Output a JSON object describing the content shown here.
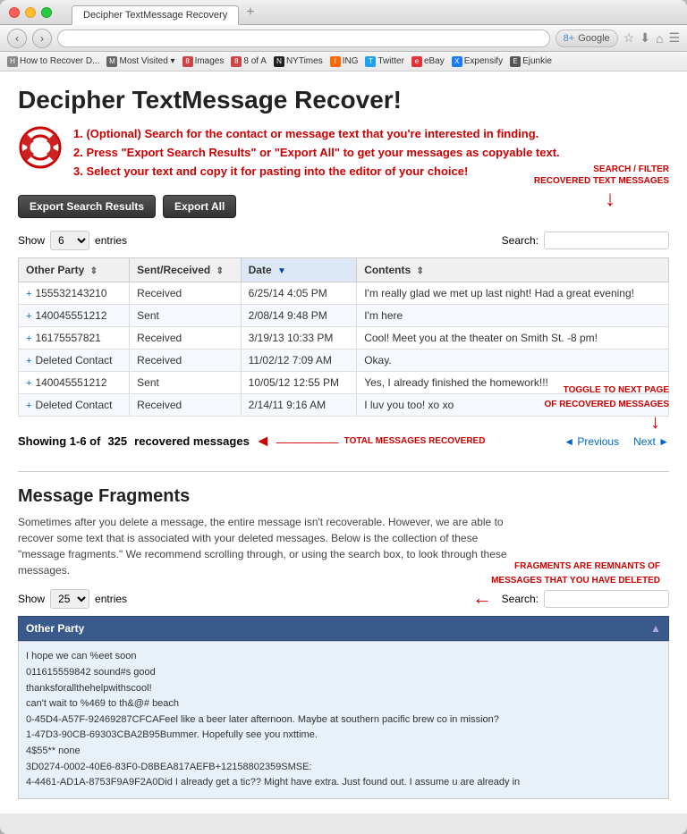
{
  "browser": {
    "tab_title": "Decipher TextMessage Recovery",
    "tab_plus": "+",
    "nav_back": "‹",
    "nav_forward": "›",
    "address": "",
    "search_placeholder": "Google",
    "bookmarks": [
      {
        "label": "How to Recover D...",
        "favicon": "H"
      },
      {
        "label": "Most Visited ▾",
        "favicon": "M"
      },
      {
        "label": "Images",
        "favicon": "8"
      },
      {
        "label": "8 of A",
        "favicon": "8"
      },
      {
        "label": "NYTimes",
        "favicon": "N"
      },
      {
        "label": "ING",
        "favicon": "I"
      },
      {
        "label": "Twitter",
        "favicon": "T"
      },
      {
        "label": "eBay",
        "favicon": "e"
      },
      {
        "label": "Expensify",
        "favicon": "X"
      },
      {
        "label": "Ejunkie",
        "favicon": "E"
      }
    ]
  },
  "page": {
    "title": "Decipher TextMessage Recover!",
    "instructions": [
      "1. (Optional) Search for the contact or message text that you're interested in finding.",
      "2. Press \"Export Search Results\" or \"Export All\" to get your messages as copyable text.",
      "3. Select your text and copy it for pasting into the editor of your choice!"
    ],
    "buttons": {
      "export_search": "Export Search Results",
      "export_all": "Export All"
    },
    "annotations": {
      "search_filter": "SEARCH / FILTER\nRECOVERED TEXT MESSAGES",
      "total_messages": "TOTAL MESSAGES RECOVERED",
      "toggle_page": "TOGGLE TO NEXT PAGE\nOF RECOVERED MESSAGES",
      "fragments_note": "FRAGMENTS ARE REMNANTS OF\nMESSAGES THAT YOU HAVE DELETED"
    },
    "table_controls": {
      "show_label": "Show",
      "show_value": "6",
      "entries_label": "entries",
      "search_label": "Search:",
      "search_value": ""
    },
    "table": {
      "columns": [
        {
          "label": "Other Party",
          "sortable": true
        },
        {
          "label": "Sent/Received",
          "sortable": true
        },
        {
          "label": "Date",
          "sortable": true,
          "active": true
        },
        {
          "label": "Contents",
          "sortable": true
        }
      ],
      "rows": [
        {
          "party": "155532143210",
          "direction": "Received",
          "date": "6/25/14  4:05 PM",
          "content": "I'm really glad we met up last night! Had a great evening!"
        },
        {
          "party": "140045551212",
          "direction": "Sent",
          "date": "2/08/14  9:48 PM",
          "content": "I'm here"
        },
        {
          "party": "16175557821",
          "direction": "Received",
          "date": "3/19/13  10:33 PM",
          "content": "Cool! Meet you at the theater on Smith St. -8 pm!"
        },
        {
          "party": "Deleted Contact",
          "direction": "Received",
          "date": "11/02/12  7:09 AM",
          "content": "Okay."
        },
        {
          "party": "140045551212",
          "direction": "Sent",
          "date": "10/05/12  12:55 PM",
          "content": "Yes, I already finished the homework!!!"
        },
        {
          "party": "Deleted Contact",
          "direction": "Received",
          "date": "2/14/11  9:16 AM",
          "content": "I luv you too! xo xo"
        }
      ]
    },
    "showing_text": "Showing 1-6 of ",
    "showing_count": "325",
    "showing_suffix": " recovered messages",
    "pagination": {
      "previous": "◄ Previous",
      "next": "Next ►"
    },
    "fragments": {
      "title": "Message Fragments",
      "description": "Sometimes after you delete a message, the entire message isn't recoverable. However, we are able to recover some text that is associated with your deleted messages. Below is the collection of these \"message fragments.\" We recommend scrolling through, or using the search box, to look through these messages.",
      "show_label": "Show",
      "show_value": "25",
      "entries_label": "entries",
      "search_label": "Search:",
      "search_value": "",
      "column_header": "Other Party",
      "content_lines": [
        "I hope we can %eet soon",
        "011615559842    sound#s good",
        "thanksforallthehelpwithscool!",
        "can't wait to %469 to th&@# beach",
        "0-45D4-A57F-92469287CFCAFeel like a beer later afternoon. Maybe at southern pacific brew co in mission?",
        "1-47D3-90CB-69303CBA2B95Bummer. Hopefully see you nxttime.",
        "4$55** none",
        "3D0274-0002-40E6-83F0-D8BEA817AEFB+12158802359SMSE:",
        "4-4461-AD1A-8753F9A9F2A0Did I already get a tic?? Might have extra. Just found out. I assume u are already in"
      ]
    }
  }
}
